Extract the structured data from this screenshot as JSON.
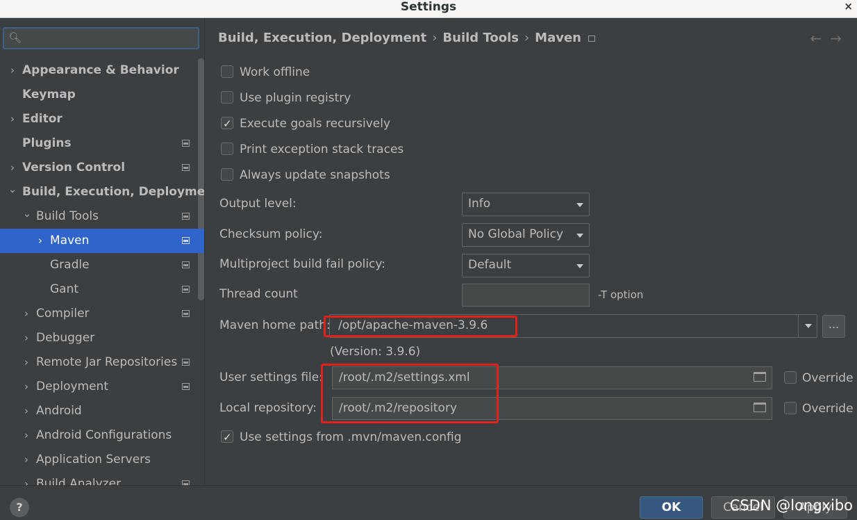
{
  "window": {
    "title": "Settings",
    "close_glyph": "×"
  },
  "search": {
    "placeholder": "",
    "value": ""
  },
  "sidebar": {
    "items": [
      {
        "label": "Appearance & Behavior",
        "expander": "›"
      },
      {
        "label": "Keymap"
      },
      {
        "label": "Editor",
        "expander": "›"
      },
      {
        "label": "Plugins"
      },
      {
        "label": "Version Control",
        "expander": "›"
      },
      {
        "label": "Build, Execution, Deployment",
        "expander": "⌄"
      },
      {
        "label": "Build Tools",
        "expander": "⌄"
      },
      {
        "label": "Maven",
        "expander": "›",
        "selected": true
      },
      {
        "label": "Gradle"
      },
      {
        "label": "Gant"
      },
      {
        "label": "Compiler",
        "expander": "›"
      },
      {
        "label": "Debugger",
        "expander": "›"
      },
      {
        "label": "Remote Jar Repositories",
        "expander": "›"
      },
      {
        "label": "Deployment",
        "expander": "›"
      },
      {
        "label": "Android",
        "expander": "›"
      },
      {
        "label": "Android Configurations",
        "expander": "›"
      },
      {
        "label": "Application Servers",
        "expander": "›"
      },
      {
        "label": "Build Analyzer",
        "expander": "›"
      }
    ]
  },
  "breadcrumb": {
    "parts": [
      "Build, Execution, Deployment",
      "Build Tools",
      "Maven"
    ],
    "separator": "›"
  },
  "nav": {
    "back": "←",
    "forward": "→"
  },
  "options": {
    "work_offline": {
      "label": "Work offline",
      "checked": false
    },
    "use_plugin_registry": {
      "label": "Use plugin registry",
      "checked": false
    },
    "execute_goals_recursively": {
      "label": "Execute goals recursively",
      "checked": true
    },
    "print_exception_stack_traces": {
      "label": "Print exception stack traces",
      "checked": false
    },
    "always_update_snapshots": {
      "label": "Always update snapshots",
      "checked": false
    }
  },
  "output_level": {
    "label": "Output level:",
    "value": "Info"
  },
  "checksum_policy": {
    "label": "Checksum policy:",
    "value": "No Global Policy"
  },
  "fail_policy": {
    "label": "Multiproject build fail policy:",
    "value": "Default"
  },
  "thread_count": {
    "label": "Thread count",
    "value": "",
    "hint": "-T  option"
  },
  "maven_home": {
    "label": "Maven home path:",
    "value": "/opt/apache-maven-3.9.6",
    "version": "(Version: 3.9.6)",
    "browse_label": "..."
  },
  "user_settings": {
    "label": "User settings file:",
    "value": "/root/.m2/settings.xml",
    "override_label": "Override"
  },
  "local_repository": {
    "label": "Local repository:",
    "value": "/root/.m2/repository",
    "override_label": "Override"
  },
  "use_mvn_config": {
    "label": "Use settings from .mvn/maven.config",
    "checked": true
  },
  "buttons": {
    "help": "?",
    "ok": "OK",
    "cancel": "Cancel",
    "apply": "Apply"
  },
  "watermark": "CSDN @longxibo",
  "colors": {
    "selection": "#2f65ca",
    "highlight_box": "#e3211b",
    "ok_button": "#365880"
  }
}
